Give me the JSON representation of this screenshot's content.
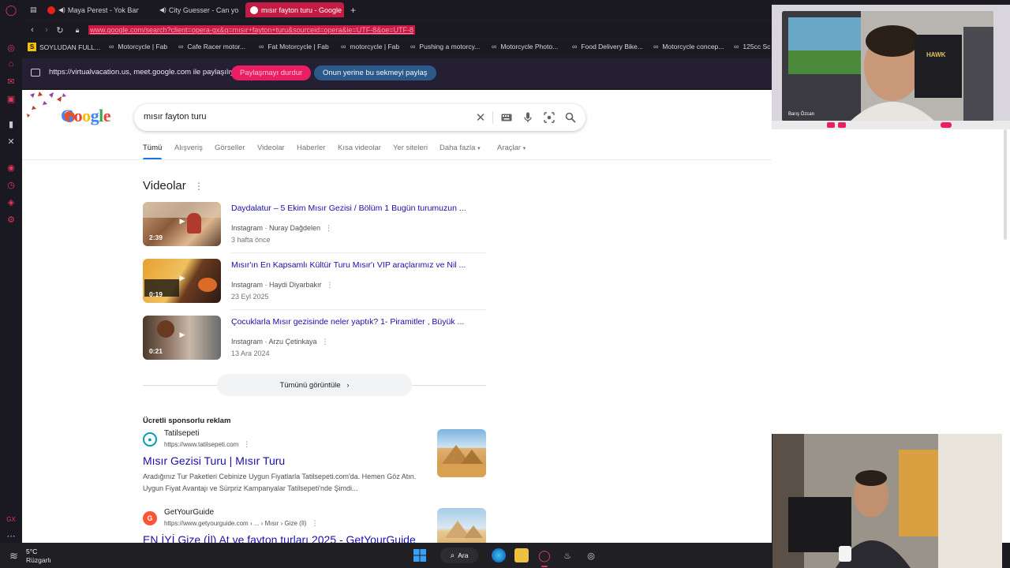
{
  "browser": {
    "tabs": [
      {
        "label": "Maya Perest - Yok Ban",
        "icon_color": "#e62117"
      },
      {
        "label": "City Guesser - Can yo",
        "icon_color": "#4285f4"
      },
      {
        "label": "mısır fayton turu - Google",
        "icon_color": "#ffffff",
        "active": true
      }
    ],
    "new_tab": "+",
    "url": "www.google.com/search?client=opera-gx&q=mısır+fayton+turu&sourceid=opera&ie=UTF-8&oe=UTF-8",
    "bookmarks": [
      {
        "label": "SOYLUDAN FULL...",
        "icon": "S"
      },
      {
        "label": "Motorcycle | Fab"
      },
      {
        "label": "Cafe Racer motor..."
      },
      {
        "label": "Fat Motorcycle | Fab"
      },
      {
        "label": "motorcycle | Fab"
      },
      {
        "label": "Pushing a motorcy..."
      },
      {
        "label": "Motorcycle Photo..."
      },
      {
        "label": "Food Delivery Bike..."
      },
      {
        "label": "Motorcycle concep..."
      },
      {
        "label": "125cc Sc"
      }
    ]
  },
  "share_bar": {
    "message": "https://virtualvacation.us, meet.google.com ile paylaşılıyor",
    "stop_label": "Paylaşmayı durdur",
    "share_tab_label": "Onun yerine bu sekmeyi paylaş"
  },
  "search": {
    "logo": "Google",
    "query": "mısır fayton turu",
    "tabs": [
      "Tümü",
      "Alışveriş",
      "Görseller",
      "Videolar",
      "Haberler",
      "Kısa videolar",
      "Yer siteleri",
      "Daha fazla",
      "Araçlar"
    ],
    "active_tab": "Tümü"
  },
  "videos": {
    "heading": "Videolar",
    "items": [
      {
        "title": "Daydalatur – 5 Ekim Mısır Gezisi / Bölüm 1 Bugün turumuzun ...",
        "source": "Instagram · Nuray Dağdelen",
        "date": "3 hafta önce",
        "duration": "2:39"
      },
      {
        "title": "Mısır'ın En Kapsamlı Kültür Turu Mısır'ı VIP araçlarımız ve Nil ...",
        "source": "Instagram · Haydi Diyarbakır",
        "date": "23 Eyl 2025",
        "duration": "0:19"
      },
      {
        "title": "Çocuklarla Mısır gezisinde neler yaptık? 1- Piramitler , Büyük ...",
        "source": "Instagram · Arzu Çetinkaya",
        "date": "13 Ara 2024",
        "duration": "0:21"
      }
    ],
    "show_all": "Tümünü görüntüle"
  },
  "ads": {
    "heading": "Ücretli sponsorlu reklam",
    "items": [
      {
        "name": "Tatilsepeti",
        "url": "https://www.tatilsepeti.com",
        "title": "Mısır Gezisi Turu | Mısır Turu",
        "desc_1": "Aradığınız Tur Paketleri Cebinize Uygun Fiyatlarla Tatilsepeti.com'da. Hemen Göz Atın.",
        "desc_2": "Uygun Fiyat Avantajı ve Sürpriz Kampanyalar Tatilsepeti'nde Şimdi...",
        "favicon_color": "#00a0b0"
      },
      {
        "name": "GetYourGuide",
        "url": "https://www.getyourguide.com › ... › Mısır › Gize (İl)",
        "title": "EN İYİ Gize (İl) At ve fayton turları 2025 - GetYourGuide",
        "favicon_color": "#ff5533",
        "favicon_letter": "G"
      }
    ]
  },
  "taskbar": {
    "temperature": "5°C",
    "weather": "Rüzgarlı",
    "search_label": "Ara"
  },
  "webcam_top": {
    "name_label": "Barış Özcan",
    "overlay_text": "HAWK"
  }
}
